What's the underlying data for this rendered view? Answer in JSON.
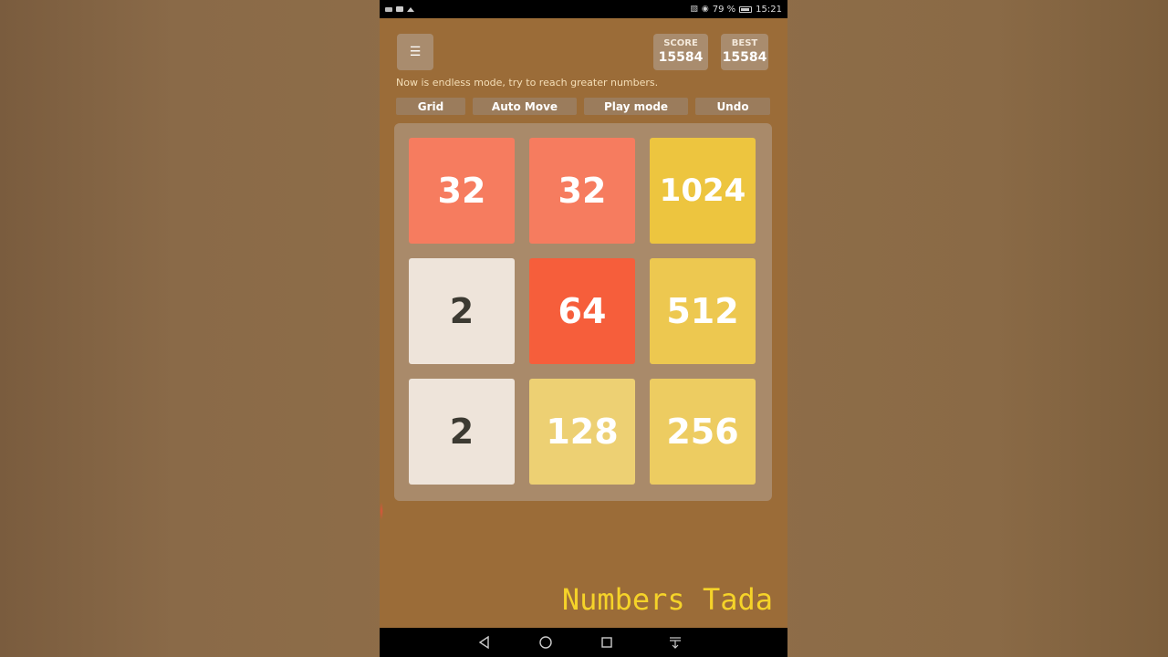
{
  "status_bar": {
    "left_icons": [
      "screen-record-icon",
      "youtube-icon",
      "cloud-icon"
    ],
    "right_icons": [
      "cast-icon",
      "eye-comfort-icon",
      "battery-icon"
    ],
    "battery": "79 %",
    "time": "15:21"
  },
  "header": {
    "menu_icon": "hamburger-icon",
    "score_label": "SCORE",
    "score_value": "15584",
    "best_label": "BEST",
    "best_value": "15584"
  },
  "hint": "Now is endless mode, try to reach greater numbers.",
  "actions": [
    {
      "label": "Grid"
    },
    {
      "label": "Auto Move"
    },
    {
      "label": "Play mode"
    },
    {
      "label": "Undo"
    }
  ],
  "board": {
    "rows": 3,
    "cols": 3,
    "tiles": [
      {
        "value": "32",
        "bg": "#f67c5f",
        "fg": "#ffffff"
      },
      {
        "value": "32",
        "bg": "#f67c5f",
        "fg": "#ffffff"
      },
      {
        "value": "1024",
        "bg": "#edc53f",
        "fg": "#ffffff"
      },
      {
        "value": "2",
        "bg": "#eee4da",
        "fg": "#3c3a32"
      },
      {
        "value": "64",
        "bg": "#f65e3b",
        "fg": "#ffffff"
      },
      {
        "value": "512",
        "bg": "#edc850",
        "fg": "#ffffff"
      },
      {
        "value": "2",
        "bg": "#eee4da",
        "fg": "#3c3a32"
      },
      {
        "value": "128",
        "bg": "#edd073",
        "fg": "#ffffff"
      },
      {
        "value": "256",
        "bg": "#edcc61",
        "fg": "#ffffff"
      }
    ]
  },
  "watermark": "Numbers Tada",
  "navbar": {
    "back": "back-icon",
    "home": "home-icon",
    "recents": "recents-icon",
    "notifications": "pull-down-icon"
  }
}
